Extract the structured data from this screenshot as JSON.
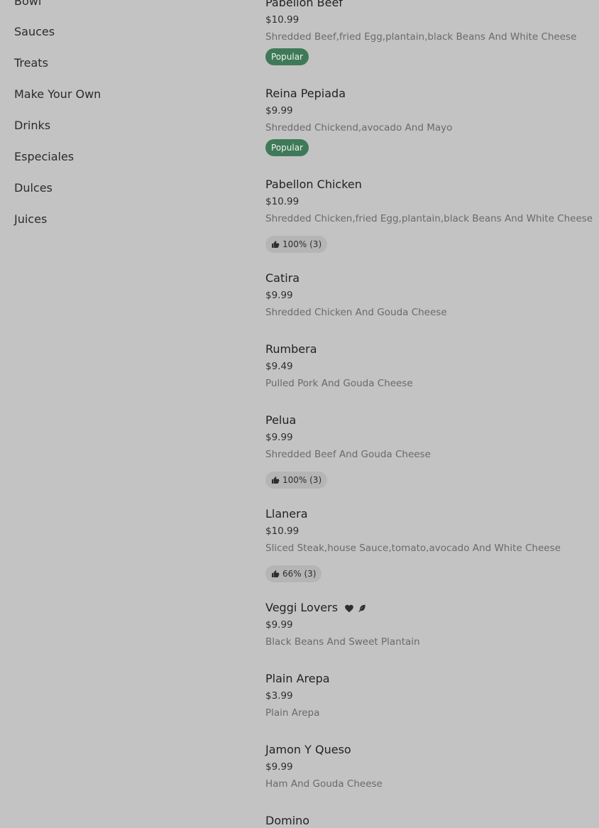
{
  "sidebar": {
    "categories": [
      "Bowl",
      "Sauces",
      "Treats",
      "Make Your Own",
      "Drinks",
      "Especiales",
      "Dulces",
      "Juices"
    ]
  },
  "menu": {
    "items": [
      {
        "name": "Pabellon Beef",
        "price": "$10.99",
        "description": "Shredded Beef,fried Egg,plantain,black Beans And White Cheese",
        "badge": "Popular"
      },
      {
        "name": "Reina Pepiada",
        "price": "$9.99",
        "description": "Shredded Chickend,avocado And Mayo",
        "badge": "Popular"
      },
      {
        "name": "Pabellon Chicken",
        "price": "$10.99",
        "description": "Shredded Chicken,fried Egg,plantain,black Beans And White Cheese",
        "rating": "100% (3)"
      },
      {
        "name": "Catira",
        "price": "$9.99",
        "description": "Shredded Chicken And Gouda Cheese"
      },
      {
        "name": "Rumbera",
        "price": "$9.49",
        "description": "Pulled Pork And Gouda Cheese"
      },
      {
        "name": "Pelua",
        "price": "$9.99",
        "description": "Shredded Beef And Gouda Cheese",
        "rating": "100% (3)"
      },
      {
        "name": "Llanera",
        "price": "$10.99",
        "description": "Sliced Steak,house Sauce,tomato,avocado And White Cheese",
        "rating": "66% (3)"
      },
      {
        "name": "Veggi Lovers",
        "price": "$9.99",
        "description": "Black Beans And Sweet Plantain",
        "tag_icons": [
          "heart-icon",
          "leaf-icon"
        ]
      },
      {
        "name": "Plain Arepa",
        "price": "$3.99",
        "description": "Plain Arepa"
      },
      {
        "name": "Jamon Y Queso",
        "price": "$9.99",
        "description": "Ham And Gouda Cheese"
      },
      {
        "name": "Domino",
        "price": "",
        "description": ""
      }
    ]
  },
  "colors": {
    "background": "#c3c3c3",
    "popular_badge": "#3f7a58",
    "rating_badge": "#b5b5b5"
  }
}
